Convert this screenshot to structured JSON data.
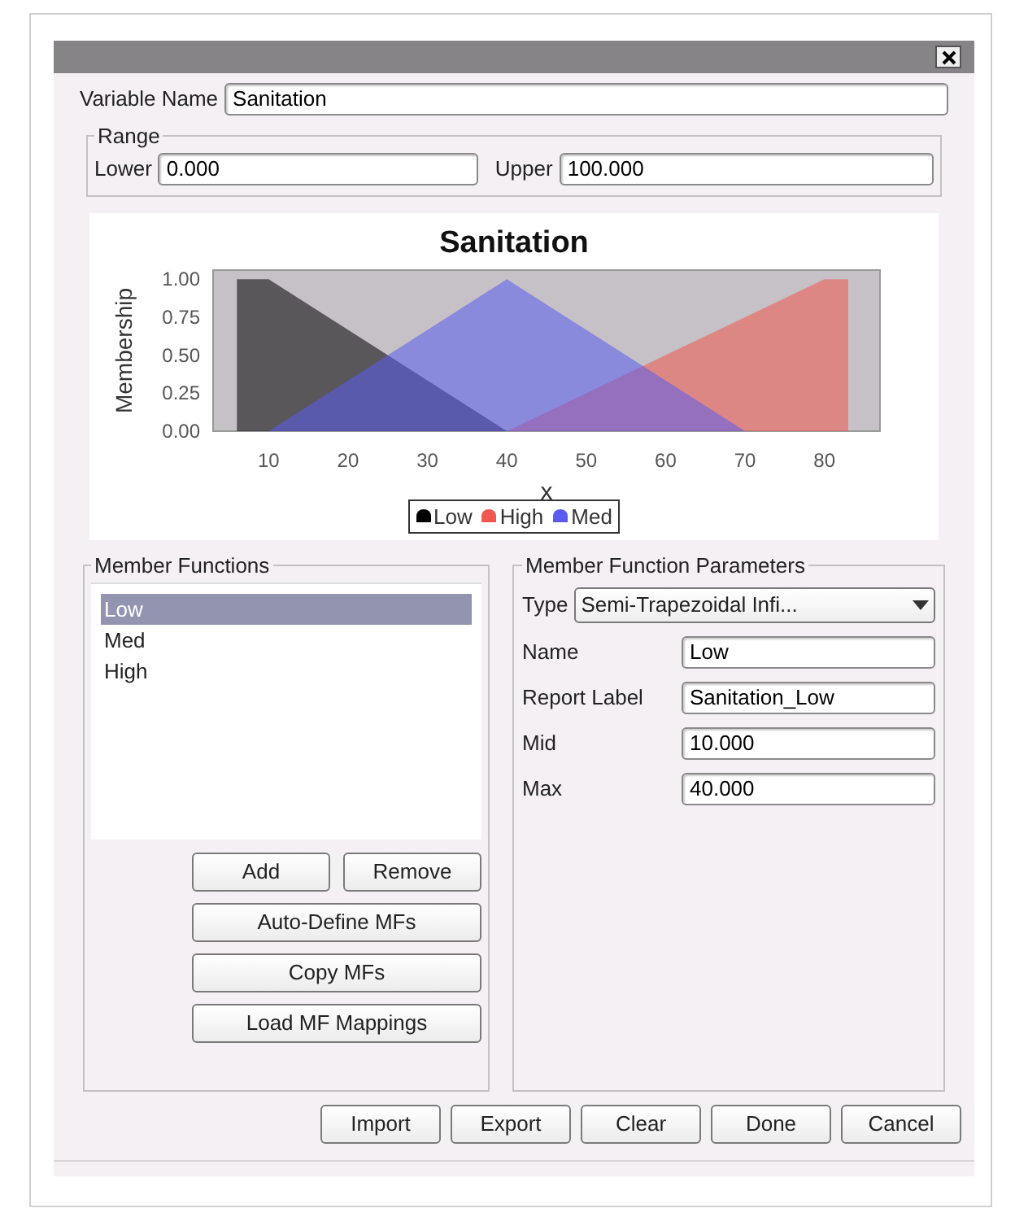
{
  "variable_name": {
    "label": "Variable Name",
    "value": "Sanitation"
  },
  "range": {
    "title": "Range",
    "lower_label": "Lower",
    "lower": "0.000",
    "upper_label": "Upper",
    "upper": "100.000"
  },
  "chart": {
    "chart_data": {
      "type": "area",
      "title": "Sanitation",
      "xlabel": "x",
      "ylabel": "Membership",
      "x": [
        6,
        10,
        40,
        70,
        80,
        83
      ],
      "series": [
        {
          "name": "Low",
          "color": "#000000",
          "values": [
            1,
            1,
            0,
            null,
            null,
            null
          ]
        },
        {
          "name": "High",
          "color": "#f0574f",
          "values": [
            null,
            null,
            0,
            0.75,
            1,
            1
          ]
        },
        {
          "name": "Med",
          "color": "#5a5cf0",
          "values": [
            null,
            0,
            1,
            0,
            null,
            null
          ]
        }
      ],
      "xlim": [
        3,
        87
      ],
      "ylim": [
        0,
        1.06
      ],
      "legend": true,
      "xticks": [
        10,
        20,
        30,
        40,
        50,
        60,
        70,
        80
      ],
      "yticks": [
        {
          "value": 0,
          "label": "0.00"
        },
        {
          "value": 0.25,
          "label": "0.25"
        },
        {
          "value": 0.5,
          "label": "0.50"
        },
        {
          "value": 0.75,
          "label": "0.75"
        },
        {
          "value": 1,
          "label": "1.00"
        }
      ]
    }
  },
  "member_functions": {
    "title": "Member Functions",
    "items": [
      {
        "label": "Low",
        "selected": true
      },
      {
        "label": "Med",
        "selected": false
      },
      {
        "label": "High",
        "selected": false
      }
    ],
    "buttons": [
      "Add",
      "Remove",
      "Auto-Define MFs",
      "Copy MFs",
      "Load MF Mappings"
    ]
  },
  "parameters": {
    "title": "Member Function Parameters",
    "type_label": "Type",
    "type_value": "Semi-Trapezoidal Infi...",
    "fields": [
      {
        "label": "Name",
        "value": "Low"
      },
      {
        "label": "Report Label",
        "value": "Sanitation_Low"
      },
      {
        "label": "Mid",
        "value": "10.000"
      },
      {
        "label": "Max",
        "value": "40.000"
      }
    ]
  },
  "buttons": [
    "Import",
    "Export",
    "Clear",
    "Done",
    "Cancel"
  ]
}
